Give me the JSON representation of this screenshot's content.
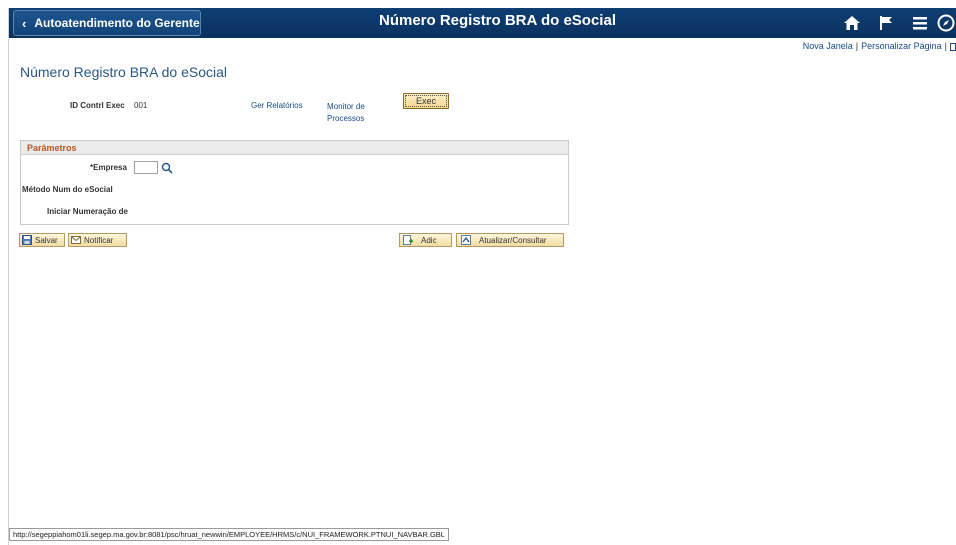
{
  "banner": {
    "back_label": "Autoatendimento do Gerente",
    "title": "Número Registro BRA do eSocial",
    "icons": [
      "home-icon",
      "flag-icon",
      "menu-icon",
      "compass-icon"
    ]
  },
  "toplinks": {
    "new_window": "Nova Janela",
    "personalize": "Personalizar Página",
    "separator": "|"
  },
  "page": {
    "title": "Número Registro BRA do eSocial"
  },
  "run": {
    "id_label": "ID Contrl Exec",
    "id_value": "001",
    "report_manager": "Ger Relatórios",
    "process_monitor": "Monitor de Processos",
    "exec_label": "Exec"
  },
  "params": {
    "header": "Parâmetros",
    "empresa_label": "*Empresa",
    "empresa_value": "",
    "metodo_label": "Método Num do eSocial",
    "iniciar_label": "Iniciar Numeração de"
  },
  "actions": {
    "save": "Salvar",
    "notify": "Notificar",
    "add": "Adic",
    "update": "Atualizar/Consultar"
  },
  "status": {
    "url": "http://segeppiahom01li.segep.ma.gov.br:8081/psc/hruat_newwin/EMPLOYEE/HRMS/c/NUI_FRAMEWORK.PTNUI_NAVBAR.GBL"
  },
  "colors": {
    "banner": "#0f3e73",
    "link": "#174c86",
    "section_header_text": "#b9541e",
    "button_bg": "#f2dca2"
  }
}
